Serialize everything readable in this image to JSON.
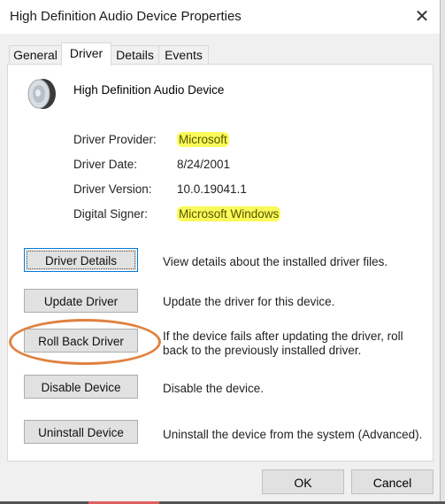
{
  "window": {
    "title": "High Definition Audio Device Properties",
    "close_icon": "close-icon"
  },
  "tabs": [
    {
      "label": "General",
      "active": false
    },
    {
      "label": "Driver",
      "active": true
    },
    {
      "label": "Details",
      "active": false
    },
    {
      "label": "Events",
      "active": false
    }
  ],
  "device": {
    "icon": "speaker-icon",
    "name": "High Definition Audio Device"
  },
  "info": [
    {
      "label": "Driver Provider:",
      "value": "Microsoft",
      "highlighted": true
    },
    {
      "label": "Driver Date:",
      "value": "8/24/2001",
      "highlighted": false
    },
    {
      "label": "Driver Version:",
      "value": "10.0.19041.1",
      "highlighted": false
    },
    {
      "label": "Digital Signer:",
      "value": "Microsoft Windows",
      "highlighted": true
    }
  ],
  "actions": [
    {
      "button": "Driver Details",
      "description": "View details about the installed driver files."
    },
    {
      "button": "Update Driver",
      "description": "Update the driver for this device."
    },
    {
      "button": "Roll Back Driver",
      "description": "If the device fails after updating the driver, roll back to the previously installed driver."
    },
    {
      "button": "Disable Device",
      "description": "Disable the device."
    },
    {
      "button": "Uninstall Device",
      "description": "Uninstall the device from the system (Advanced)."
    }
  ],
  "footer": {
    "ok": "OK",
    "cancel": "Cancel"
  },
  "annotation": {
    "color": "#e0813f",
    "target": "Roll Back Driver"
  },
  "highlight_color": "#fafa5a"
}
